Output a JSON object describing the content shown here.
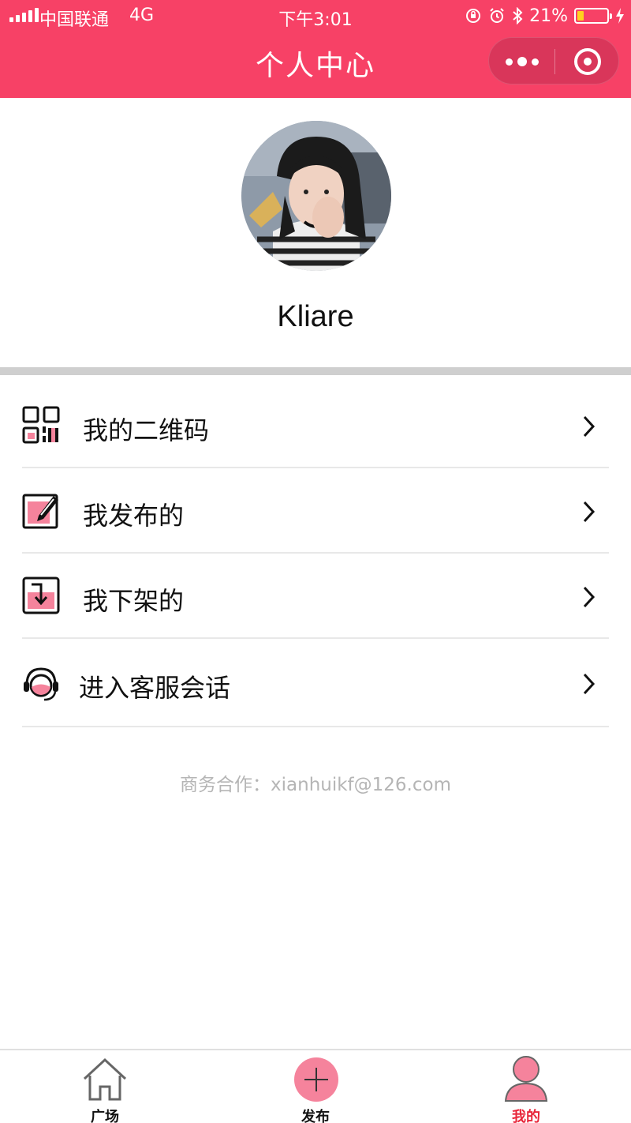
{
  "status_bar": {
    "carrier": "中国联通",
    "network": "4G",
    "time": "下午3:01",
    "battery_percent": "21%"
  },
  "nav": {
    "title": "个人中心"
  },
  "profile": {
    "username": "Kliare"
  },
  "menu": [
    {
      "label": "我的二维码",
      "icon": "qr-code-icon"
    },
    {
      "label": "我发布的",
      "icon": "edit-icon"
    },
    {
      "label": "我下架的",
      "icon": "download-box-icon"
    },
    {
      "label": "进入客服会话",
      "icon": "headset-icon"
    }
  ],
  "footer": {
    "contact": "商务合作：xianhuikf@126.com"
  },
  "tabbar": [
    {
      "label": "广场",
      "icon": "home-icon"
    },
    {
      "label": "发布",
      "icon": "plus-icon"
    },
    {
      "label": "我的",
      "icon": "user-icon",
      "active": true
    }
  ],
  "colors": {
    "brand": "#f74166",
    "accent_pink": "#f5839c",
    "active_tab": "#e8263a"
  }
}
